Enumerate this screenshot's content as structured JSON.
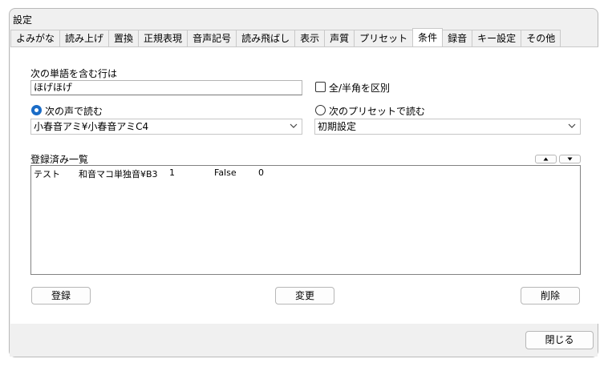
{
  "window": {
    "title": "設定"
  },
  "tabs": [
    {
      "label": "よみがな"
    },
    {
      "label": "読み上げ"
    },
    {
      "label": "置換"
    },
    {
      "label": "正規表現"
    },
    {
      "label": "音声記号"
    },
    {
      "label": "読み飛ばし"
    },
    {
      "label": "表示"
    },
    {
      "label": "声質"
    },
    {
      "label": "プリセット"
    },
    {
      "label": "条件",
      "active": true
    },
    {
      "label": "録音"
    },
    {
      "label": "キー設定"
    },
    {
      "label": "その他"
    }
  ],
  "condition": {
    "word_label": "次の単語を含む行は",
    "word_value": "ほげほげ",
    "fullhalf_label": "全/半角を区別",
    "fullhalf_checked": false,
    "voice_radio_label": "次の声で読む",
    "voice_radio_selected": true,
    "voice_select_value": "小春音アミ¥小春音アミC4",
    "preset_radio_label": "次のプリセットで読む",
    "preset_radio_selected": false,
    "preset_select_value": "初期設定"
  },
  "registered": {
    "label": "登録済み一覧",
    "up_icon": "triangle-up-icon",
    "down_icon": "triangle-down-icon",
    "rows": [
      {
        "word": "テスト",
        "voice": "和音マコ単独音¥B3",
        "num": "1",
        "flag": "False",
        "extra": "0"
      }
    ]
  },
  "buttons": {
    "register": "登録",
    "change": "変更",
    "delete": "削除",
    "close": "閉じる"
  }
}
